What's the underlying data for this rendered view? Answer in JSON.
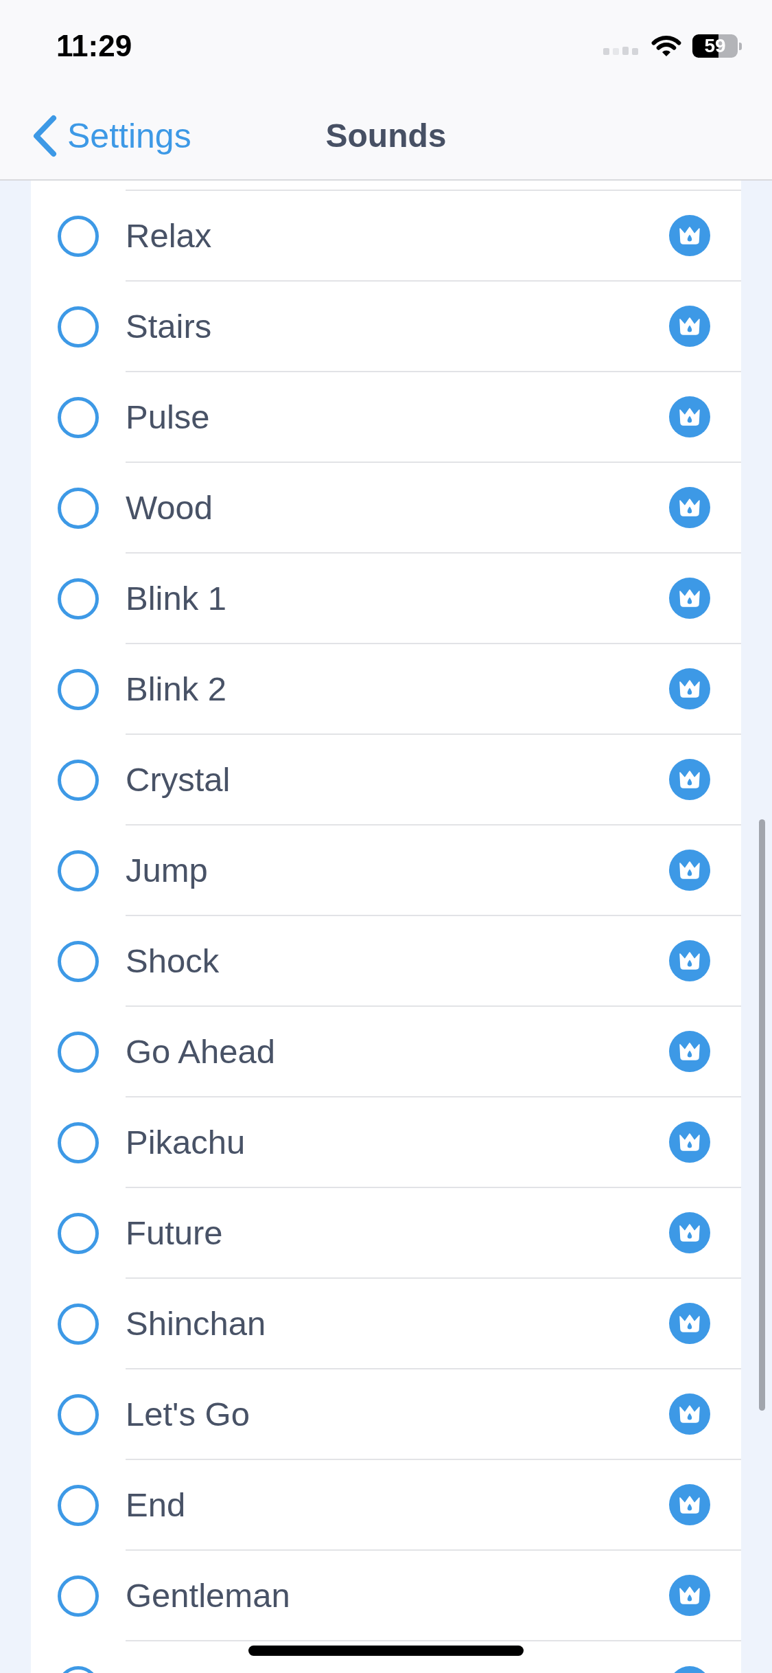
{
  "status_bar": {
    "time": "11:29",
    "battery": "59"
  },
  "nav_bar": {
    "back_label": "Settings",
    "title": "Sounds"
  },
  "sounds": [
    {
      "kind": "row",
      "label": "Relax",
      "selected": false
    },
    {
      "kind": "row",
      "label": "Stairs",
      "selected": false
    },
    {
      "kind": "row",
      "label": "Pulse",
      "selected": false
    },
    {
      "kind": "row",
      "label": "Wood",
      "selected": false
    },
    {
      "kind": "row",
      "label": "Blink 1",
      "selected": false
    },
    {
      "kind": "row",
      "label": "Blink 2",
      "selected": false
    },
    {
      "kind": "row",
      "label": "Crystal",
      "selected": false
    },
    {
      "kind": "row",
      "label": "Jump",
      "selected": false
    },
    {
      "kind": "row",
      "label": "Shock",
      "selected": false
    },
    {
      "kind": "row",
      "label": "Go Ahead",
      "selected": false
    },
    {
      "kind": "row",
      "label": "Pikachu",
      "selected": false
    },
    {
      "kind": "row",
      "label": "Future",
      "selected": false
    },
    {
      "kind": "row",
      "label": "Shinchan",
      "selected": false
    },
    {
      "kind": "row",
      "label": "Let's Go",
      "selected": false
    },
    {
      "kind": "row",
      "label": "End",
      "selected": false
    },
    {
      "kind": "row",
      "label": "Gentleman",
      "selected": false
    },
    {
      "kind": "cut_off",
      "selected": false
    }
  ]
}
